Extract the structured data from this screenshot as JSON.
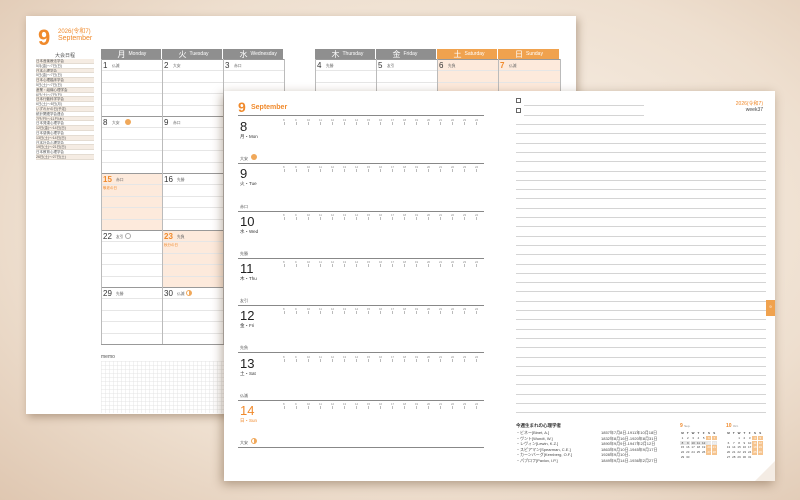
{
  "monthly": {
    "month_number": "9",
    "era_year": "2026(令和7)",
    "month_en": "September",
    "events_title": "大会日程",
    "events": [
      "日本音楽療法学会",
      "5月(金)〜7日(日)",
      "日本心理学会",
      "5日(金)〜7日(日)",
      "日本心理臨床学会",
      "5日(土)〜7日(日)",
      "産業・組織心理学会",
      "6日(土)〜7日(日)",
      "日本行動科学学会",
      "6日(土)〜8日(月)",
      "いずれかの日(予定)",
      "統計関連学会連合",
      "7日(日)〜11日(木)",
      "日本発達心理学会",
      "12日(金)〜14日(日)",
      "日本感情心理学会",
      "13日(土)〜14日(日)",
      "日本社会心理学会",
      "19日(土)〜21日(日)",
      "日本教育心理学会",
      "26日(土)〜27日(土)"
    ],
    "weekdays": [
      {
        "jp": "月",
        "en": "Monday"
      },
      {
        "jp": "火",
        "en": "Tuesday"
      },
      {
        "jp": "水",
        "en": "Wednesday"
      },
      {
        "jp": "木",
        "en": "Thursday"
      },
      {
        "jp": "金",
        "en": "Friday"
      },
      {
        "jp": "土",
        "en": "Saturday"
      },
      {
        "jp": "日",
        "en": "Sunday"
      }
    ],
    "head_colors": {
      "weekday": "#8f8f8f",
      "weekend": "#f0a24e"
    },
    "days": [
      {
        "d": "1",
        "r": "仏滅",
        "col": 0,
        "row": 0
      },
      {
        "d": "2",
        "r": "大安",
        "col": 1,
        "row": 0
      },
      {
        "d": "3",
        "r": "赤口",
        "col": 2,
        "row": 0
      },
      {
        "d": "4",
        "r": "先勝",
        "col": 3,
        "row": 0
      },
      {
        "d": "5",
        "r": "友引",
        "col": 4,
        "row": 0
      },
      {
        "d": "6",
        "r": "先負",
        "col": 5,
        "row": 0
      },
      {
        "d": "7",
        "r": "仏滅",
        "col": 6,
        "row": 0,
        "or": true
      },
      {
        "d": "8",
        "r": "大安",
        "col": 0,
        "row": 1,
        "moon": "full"
      },
      {
        "d": "9",
        "r": "赤口",
        "col": 1,
        "row": 1
      },
      {
        "d": "15",
        "r": "赤口",
        "col": 0,
        "row": 2,
        "or": true,
        "hol": "敬老の日"
      },
      {
        "d": "16",
        "r": "先勝",
        "col": 1,
        "row": 2
      },
      {
        "d": "22",
        "r": "友引",
        "col": 0,
        "row": 3,
        "moon": "new"
      },
      {
        "d": "23",
        "r": "先負",
        "col": 1,
        "row": 3,
        "or": true,
        "hol": "秋分の日"
      },
      {
        "d": "29",
        "r": "先勝",
        "col": 0,
        "row": 4
      },
      {
        "d": "30",
        "r": "仏滅",
        "col": 1,
        "row": 4,
        "moon": "half"
      }
    ],
    "memo_label": "memo"
  },
  "weekly": {
    "month_number": "9",
    "month_en": "September",
    "year_label": "2026(令和7)",
    "week_label": "week37",
    "days": [
      {
        "d": "8",
        "wd": "月・Mon",
        "r": "大安",
        "moon": "full"
      },
      {
        "d": "9",
        "wd": "火・Tue",
        "r": "赤口"
      },
      {
        "d": "10",
        "wd": "水・Wed",
        "r": "先勝"
      },
      {
        "d": "11",
        "wd": "木・Thu",
        "r": "友引"
      },
      {
        "d": "12",
        "wd": "金・Fri",
        "r": "先負"
      },
      {
        "d": "13",
        "wd": "土・Sat",
        "r": "仏滅"
      },
      {
        "d": "14",
        "wd": "日・Sun",
        "r": "大安",
        "or": true,
        "moon": "half"
      }
    ],
    "hours": [
      "8",
      "9",
      "10",
      "11",
      "12",
      "13",
      "14",
      "15",
      "16",
      "17",
      "18",
      "19",
      "20",
      "21",
      "22",
      "23",
      "24"
    ],
    "tab_label": "9",
    "psych_title": "今週生まれの心理学者",
    "psych": [
      {
        "name": "・ビネー[Binet, A.]",
        "dates": "1857年7月8日-1911年10月18日"
      },
      {
        "name": "・ヴント[Wundt, W.]",
        "dates": "1832年8月16日-1920年8月31日"
      },
      {
        "name": "・レヴィン[Lewin, K.Z.]",
        "dates": "1890年9月9日-1947年2月12日"
      },
      {
        "name": "・スピアマン[Spearman, C.E.]",
        "dates": "1863年9月10日-1945年9月17日"
      },
      {
        "name": "・カーンバーグ[Kernberg, O.F.]",
        "dates": "1928年9月10日-"
      },
      {
        "name": "・パブロフ[Pavlov, I.P.]",
        "dates": "1849年9月14日-1936年2月27日"
      }
    ],
    "mini_cals": [
      {
        "month": "9",
        "en": "Sep.",
        "head": [
          "M",
          "T",
          "W",
          "T",
          "F",
          "S",
          "S"
        ],
        "days": [
          "1",
          "2",
          "3",
          "4",
          "5",
          "6",
          "7",
          "8",
          "9",
          "10",
          "11",
          "12",
          "13",
          "14",
          "15",
          "16",
          "17",
          "18",
          "19",
          "20",
          "21",
          "22",
          "23",
          "24",
          "25",
          "26",
          "27",
          "28",
          "29",
          "30"
        ],
        "start": 0
      },
      {
        "month": "10",
        "en": "Oct.",
        "head": [
          "M",
          "T",
          "W",
          "T",
          "F",
          "S",
          "S"
        ],
        "days": [
          "1",
          "2",
          "3",
          "4",
          "5",
          "6",
          "7",
          "8",
          "9",
          "10",
          "11",
          "12",
          "13",
          "14",
          "15",
          "16",
          "17",
          "18",
          "19",
          "20",
          "21",
          "22",
          "23",
          "24",
          "25",
          "26",
          "27",
          "28",
          "29",
          "30",
          "31"
        ],
        "start": 2
      }
    ]
  },
  "colors": {
    "accent": "#f08a2c",
    "weekend_fill": "#fdeadc"
  }
}
